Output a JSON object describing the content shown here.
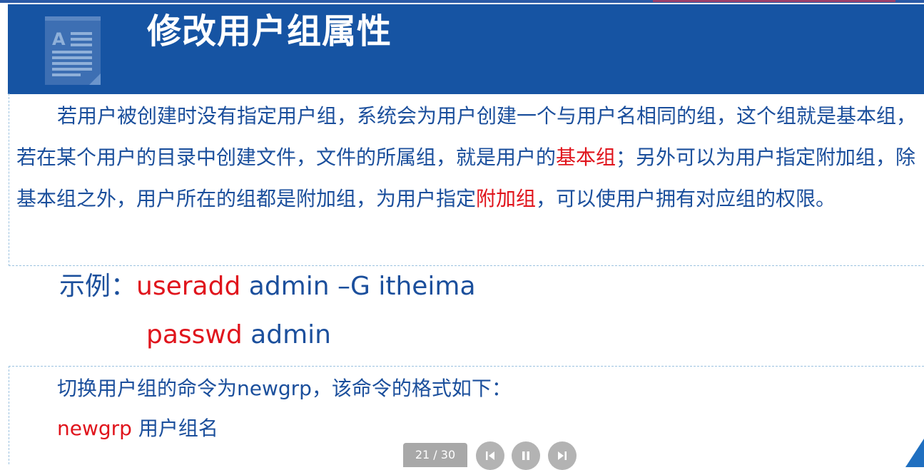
{
  "slide": {
    "title": "修改用户组属性"
  },
  "paragraph1": {
    "part1": "若用户被创建时没有指定用户组，系统会为用户创建一个与用户名相同的组，这个组就是基本组，若在某个用户的目录中创建文件，文件的所属组，就是用户的",
    "highlight1": "基本组",
    "part2": "；另外可以为用户指定附加组，除基本组之外，用户所在的组都是附加组，为用户指定",
    "highlight2": "附加组",
    "part3": "，可以使用户拥有对应组的权限。"
  },
  "example": {
    "label": "示例：",
    "cmd1_keyword": "useradd",
    "cmd1_args": " admin –G itheima",
    "cmd2_keyword": "passwd",
    "cmd2_args": " admin"
  },
  "newgrp_box": {
    "line1": "切换用户组的命令为newgrp，该命令的格式如下：",
    "line2_keyword": "newgrp",
    "line2_rest": " 用户组名"
  },
  "player": {
    "counter": "21 / 30",
    "prev_icon": "skip-previous-icon",
    "pause_icon": "pause-icon",
    "next_icon": "skip-next-icon"
  },
  "colors": {
    "header_bg": "#1654a3",
    "text_blue": "#1b4f9c",
    "highlight_red": "#e0141c"
  }
}
